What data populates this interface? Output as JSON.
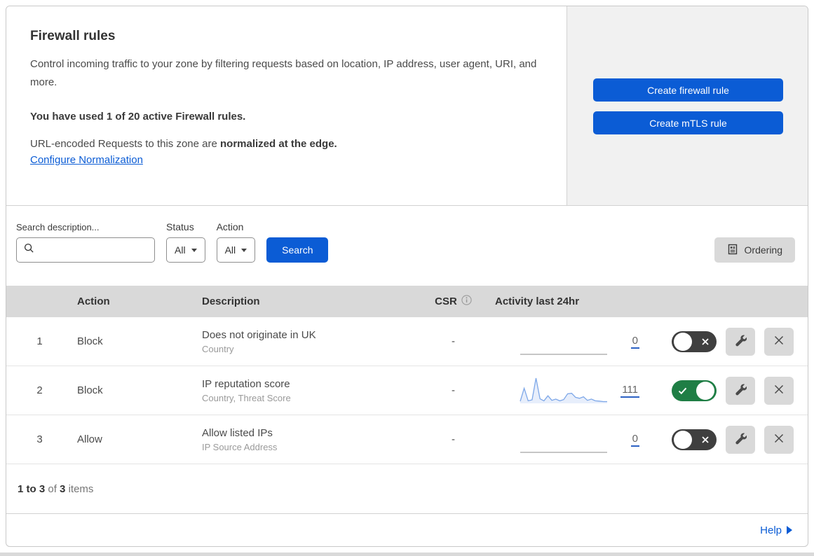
{
  "colors": {
    "accent_blue": "#0b5cd5",
    "toggle_on": "#1f7e45",
    "toggle_off": "#3f3f3f",
    "panel_bg": "#f1f1f1",
    "table_header_bg": "#d9d9d9",
    "sparkline_blue": "#7da7e8"
  },
  "hero": {
    "title": "Firewall rules",
    "description": "Control incoming traffic to your zone by filtering requests based on location, IP address, user agent, URI, and more.",
    "usage": "You have used 1 of 20 active Firewall rules.",
    "normalization_prefix": "URL-encoded Requests to this zone are ",
    "normalization_bold": "normalized at the edge.",
    "normalization_link": "Configure Normalization",
    "create_firewall_button": "Create firewall rule",
    "create_mtls_button": "Create mTLS rule"
  },
  "filters": {
    "search_label": "Search description...",
    "status_label": "Status",
    "status_value": "All",
    "action_label": "Action",
    "action_value": "All",
    "search_button": "Search",
    "ordering_button": "Ordering"
  },
  "table": {
    "headers": {
      "action": "Action",
      "description": "Description",
      "csr": "CSR",
      "activity": "Activity last 24hr"
    },
    "rows": [
      {
        "num": "1",
        "action": "Block",
        "description": "Does not originate in UK",
        "fields": "Country",
        "csr": "-",
        "enabled": false,
        "activity": {
          "count": "0",
          "sparkline": [
            0,
            0
          ],
          "line_color": "#a3a3a3",
          "fill_color": "none"
        }
      },
      {
        "num": "2",
        "action": "Block",
        "description": "IP reputation score",
        "fields": "Country, Threat Score",
        "csr": "-",
        "enabled": true,
        "activity": {
          "count": "111",
          "sparkline": [
            8,
            60,
            10,
            14,
            100,
            18,
            10,
            30,
            12,
            17,
            10,
            15,
            38,
            40,
            24,
            20,
            26,
            12,
            17,
            10,
            9,
            7,
            7
          ],
          "line_color": "#7da7e8",
          "fill_color": "#e7eefb"
        }
      },
      {
        "num": "3",
        "action": "Allow",
        "description": "Allow listed IPs",
        "fields": "IP Source Address",
        "csr": "-",
        "enabled": false,
        "activity": {
          "count": "0",
          "sparkline": [
            0,
            0
          ],
          "line_color": "#a3a3a3",
          "fill_color": "none"
        }
      }
    ]
  },
  "footer": {
    "range": "1 to 3",
    "of": "of",
    "total": "3",
    "items": "items"
  },
  "help": {
    "label": "Help"
  }
}
